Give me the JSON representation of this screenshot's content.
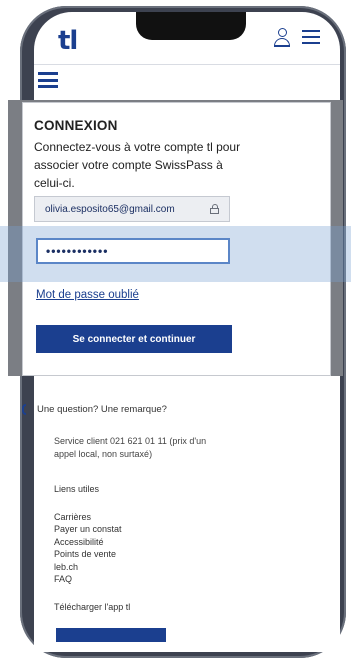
{
  "header": {
    "brand": "tl"
  },
  "login": {
    "title": "CONNEXION",
    "description": "Connectez-vous à votre compte tl pour associer votre compte SwissPass à celui-ci.",
    "email": "olivia.esposito65@gmail.com",
    "password_masked": "••••••••••••",
    "forgot_label": "Mot de passe oublié",
    "submit_label": "Se connecter et continuer"
  },
  "footer": {
    "contact": "Une question? Une remarque?",
    "service": "Service client 021 621 01 11 (prix d'un appel local, non surtaxé)",
    "links_title": "Liens utiles",
    "links": [
      "Carrières",
      "Payer un constat",
      "Accessibilité",
      "Points de vente",
      "leb.ch",
      "FAQ"
    ],
    "download": "Télécharger l'app tl"
  },
  "colors": {
    "brand": "#1b3f8f",
    "focus": "#5b86c7"
  }
}
